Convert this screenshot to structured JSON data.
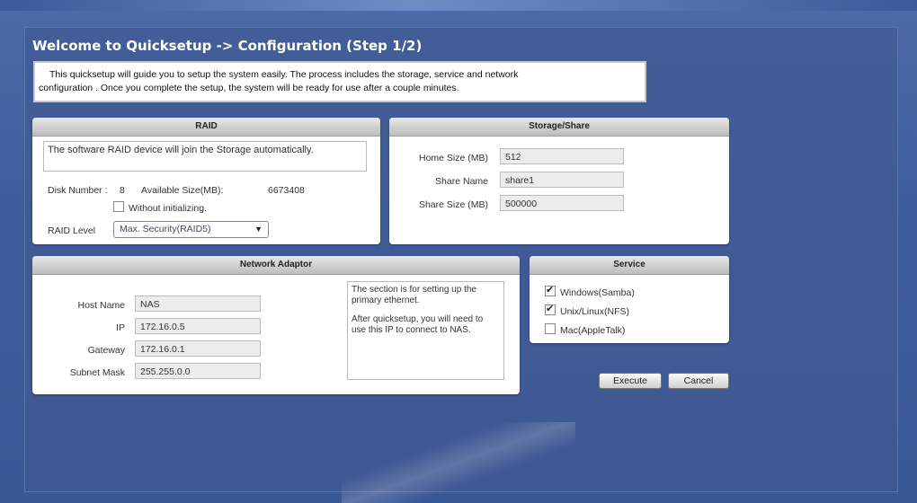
{
  "title": "Welcome to Quicksetup -> Configuration (Step 1/2)",
  "intro": {
    "line1": "This quicksetup will guide you to setup the system easily. The process includes the storage, service and network",
    "line2": "configuration . Once you complete the setup, the system will be ready for use after a couple minutes."
  },
  "raid": {
    "header": "RAID",
    "note": "The software RAID device will join the Storage automatically.",
    "disk_label": "Disk Number :",
    "disk_value": "8",
    "avail_label": "Available Size(MB):",
    "avail_value": "6673408",
    "without_init_label": "Without initializing.",
    "level_label": "RAID Level",
    "level_value": "Max. Security(RAID5)"
  },
  "storage": {
    "header": "Storage/Share",
    "home_label": "Home Size (MB)",
    "home_value": "512",
    "share_name_label": "Share Name",
    "share_name_value": "share1",
    "share_size_label": "Share Size (MB)",
    "share_size_value": "500000"
  },
  "network": {
    "header": "Network Adaptor",
    "host_label": "Host Name",
    "host_value": "NAS",
    "ip_label": "IP",
    "ip_value": "172.16.0.5",
    "gateway_label": "Gateway",
    "gateway_value": "172.16.0.1",
    "mask_label": "Subnet Mask",
    "mask_value": "255.255.0.0",
    "info1": "The section is for setting up the primary ethernet.",
    "info2": "After quicksetup, you will need to use this IP to connect to NAS."
  },
  "service": {
    "header": "Service",
    "items": [
      {
        "label": "Windows(Samba)",
        "checked": true
      },
      {
        "label": "Unix/Linux(NFS)",
        "checked": true
      },
      {
        "label": "Mac(AppleTalk)",
        "checked": false
      }
    ]
  },
  "buttons": {
    "execute": "Execute",
    "cancel": "Cancel"
  }
}
